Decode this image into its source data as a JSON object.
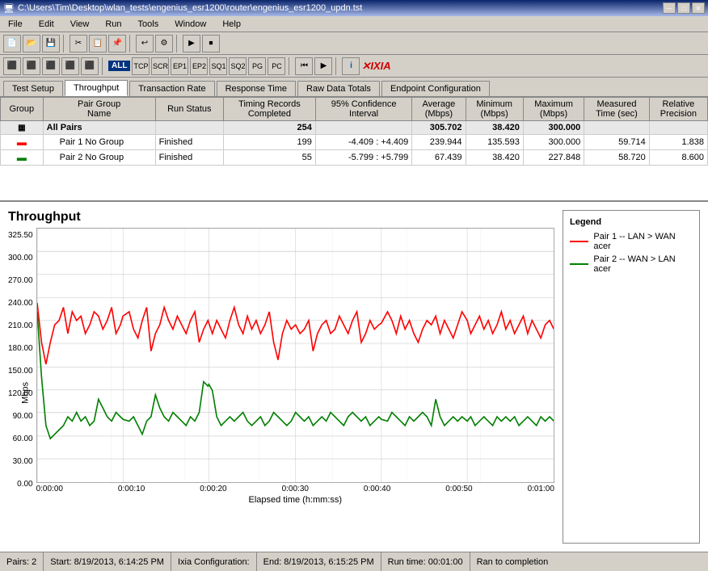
{
  "titlebar": {
    "title": "C:\\Users\\Tim\\Desktop\\wlan_tests\\engenius_esr1200\\router\\engenius_esr1200_updn.tst",
    "minimize": "—",
    "maximize": "□",
    "close": "✕"
  },
  "menubar": {
    "items": [
      "File",
      "Edit",
      "View",
      "Run",
      "Tools",
      "Window",
      "Help"
    ]
  },
  "toolbar1": {
    "all_label": "ALL",
    "protocol_labels": [
      "TCP",
      "SCR",
      "EP1",
      "EP2",
      "SQ1",
      "SQ2",
      "PG",
      "PC"
    ]
  },
  "tabs": {
    "items": [
      "Test Setup",
      "Throughput",
      "Transaction Rate",
      "Response Time",
      "Raw Data Totals",
      "Endpoint Configuration"
    ],
    "active": "Throughput"
  },
  "table": {
    "headers": {
      "group": "Group",
      "pair_group_name": "Pair Group Name",
      "run_status": "Run Status",
      "timing_records_completed": "Timing Records Completed",
      "confidence_interval_95": "95% Confidence Interval",
      "average_mbps": "Average (Mbps)",
      "minimum_mbps": "Minimum (Mbps)",
      "maximum_mbps": "Maximum (Mbps)",
      "measured_time_sec": "Measured Time (sec)",
      "relative_precision": "Relative Precision"
    },
    "rows": [
      {
        "type": "allpairs",
        "group": "",
        "pair_group_name": "All Pairs",
        "run_status": "",
        "timing_records": "254",
        "confidence_interval": "",
        "average_mbps": "305.702",
        "minimum_mbps": "38.420",
        "maximum_mbps": "300.000",
        "measured_time": "",
        "relative_precision": ""
      },
      {
        "type": "pair",
        "group": "",
        "pair_group_name": "Pair 1  No Group",
        "run_status": "Finished",
        "timing_records": "199",
        "confidence_interval": "-4.409 : +4.409",
        "average_mbps": "239.944",
        "minimum_mbps": "135.593",
        "maximum_mbps": "300.000",
        "measured_time": "59.714",
        "relative_precision": "1.838"
      },
      {
        "type": "pair",
        "group": "",
        "pair_group_name": "Pair 2  No Group",
        "run_status": "Finished",
        "timing_records": "55",
        "confidence_interval": "-5.799 : +5.799",
        "average_mbps": "67.439",
        "minimum_mbps": "38.420",
        "maximum_mbps": "227.848",
        "measured_time": "58.720",
        "relative_precision": "8.600"
      }
    ]
  },
  "chart": {
    "title": "Throughput",
    "y_axis_label": "Mbps",
    "x_axis_label": "Elapsed time (h:mm:ss)",
    "y_ticks": [
      "325.50",
      "300.00",
      "270.00",
      "240.00",
      "210.00",
      "180.00",
      "150.00",
      "120.00",
      "90.00",
      "60.00",
      "30.00",
      "0.00"
    ],
    "x_ticks": [
      "0:00:00",
      "0:00:10",
      "0:00:20",
      "0:00:30",
      "0:00:40",
      "0:00:50",
      "0:01:00"
    ]
  },
  "legend": {
    "title": "Legend",
    "items": [
      {
        "color": "red",
        "label": "Pair 1 -- LAN > WAN acer"
      },
      {
        "color": "green",
        "label": "Pair 2 -- WAN > LAN acer"
      }
    ]
  },
  "statusbar": {
    "pairs": "Pairs: 2",
    "start": "Start: 8/19/2013, 6:14:25 PM",
    "ixia_config": "Ixia Configuration:",
    "end": "End: 8/19/2013, 6:15:25 PM",
    "run_time": "Run time: 00:01:00",
    "status": "Ran to completion"
  }
}
